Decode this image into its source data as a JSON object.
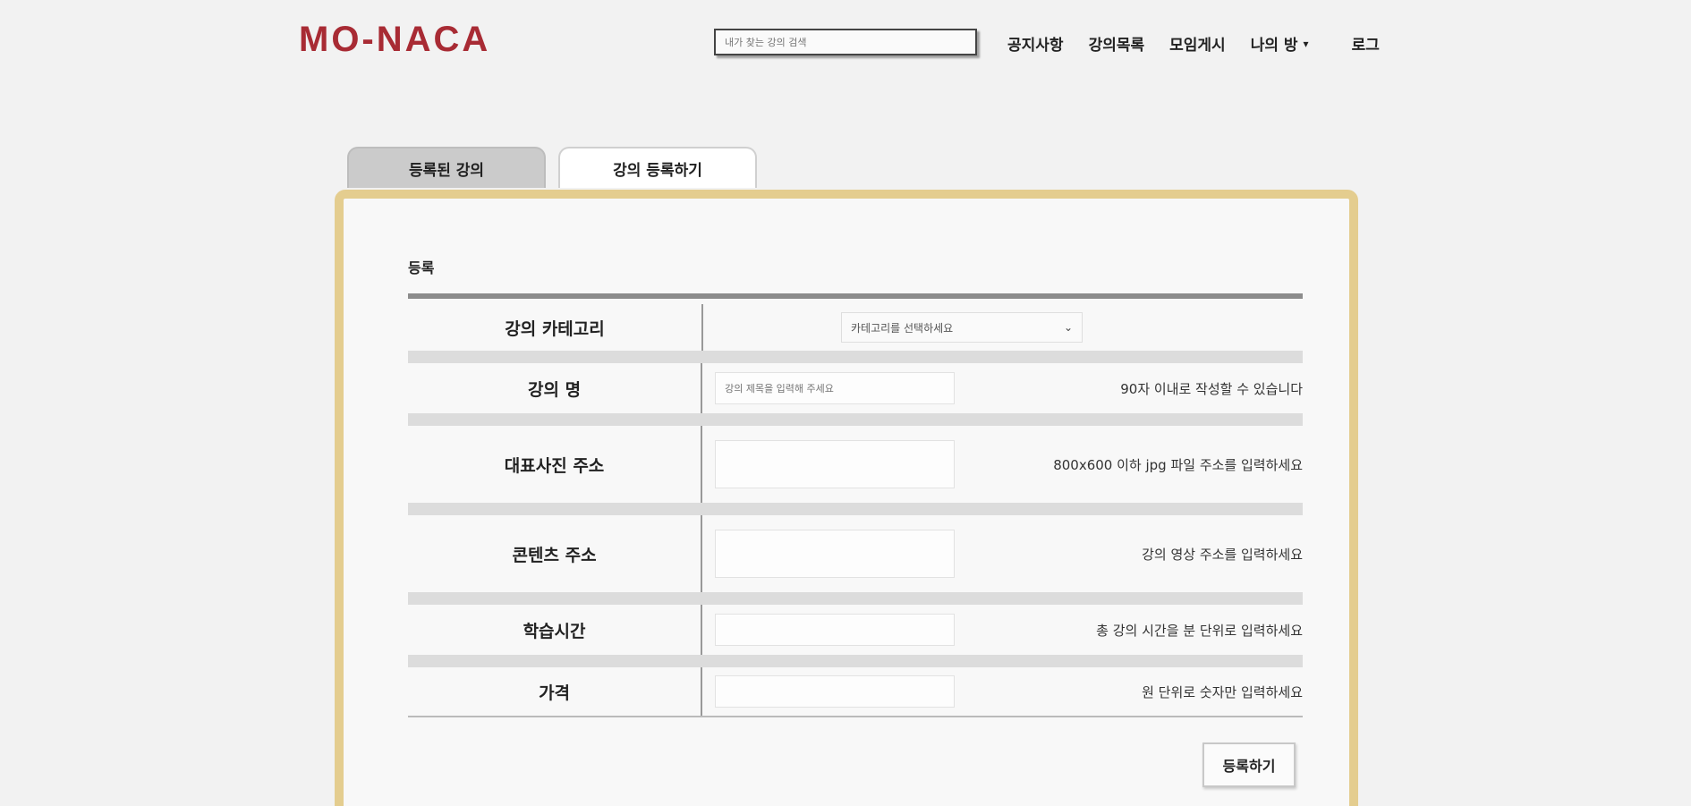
{
  "header": {
    "logo": "MO-NACA",
    "search_placeholder": "내가 찾는 강의 검색",
    "nav": {
      "notice": "공지사항",
      "lectures": "강의목록",
      "community": "모임게시",
      "mypage": "나의 방",
      "logout": "로그"
    }
  },
  "tabs": [
    {
      "label": "등록된 강의",
      "active": true
    },
    {
      "label": "강의 등록하기",
      "active": false
    }
  ],
  "form": {
    "section_title": "등록",
    "fields": [
      {
        "label": "강의 카테고리",
        "kind": "select",
        "value": "카테고리를 선택하세요",
        "hint": ""
      },
      {
        "label": "강의 명",
        "kind": "input",
        "placeholder": "강의 제목을 입력해 주세요",
        "hint": "90자 이내로 작성할 수 있습니다"
      },
      {
        "label": "대표사진 주소",
        "kind": "input-tall",
        "placeholder": "",
        "hint": "800x600 이하 jpg 파일 주소를 입력하세요"
      },
      {
        "label": "콘텐츠 주소",
        "kind": "input-tall",
        "placeholder": "",
        "hint": "강의 영상 주소를 입력하세요"
      },
      {
        "label": "학습시간",
        "kind": "input",
        "placeholder": "",
        "hint": "총 강의 시간을 분 단위로 입력하세요"
      },
      {
        "label": "가격",
        "kind": "input",
        "placeholder": "",
        "hint": "원 단위로 숫자만 입력하세요"
      }
    ],
    "submit_label": "등록하기"
  }
}
